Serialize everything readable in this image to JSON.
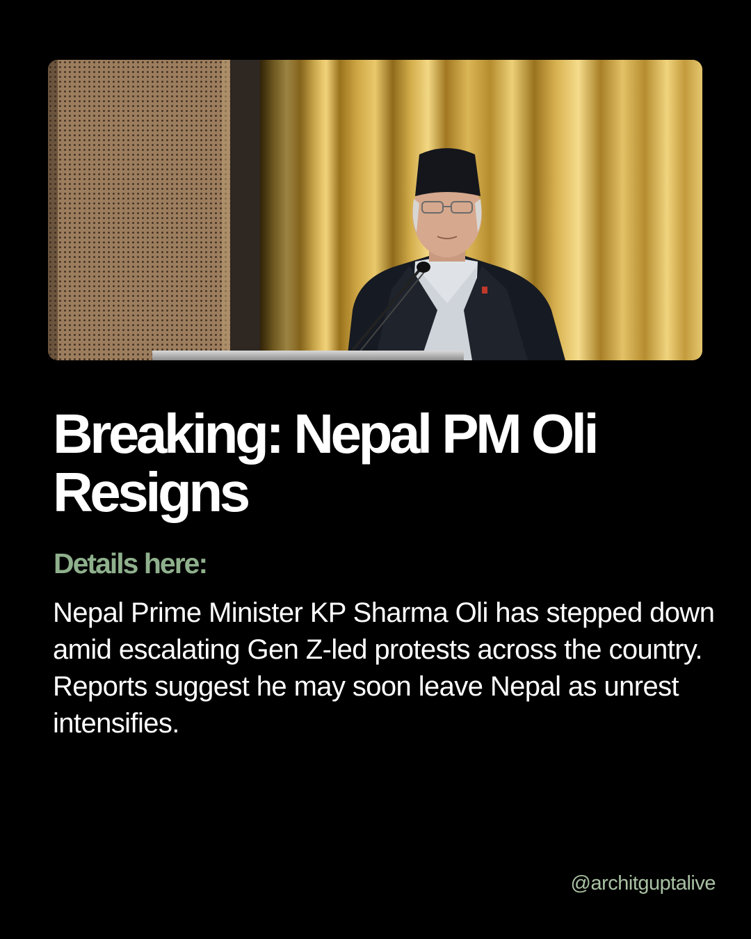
{
  "post": {
    "headline": "Breaking: Nepal PM Oli Resigns",
    "subheading": "Details here:",
    "body": "Nepal Prime Minister KP Sharma Oli has stepped down amid escalating Gen Z-led protests across the country. Reports suggest he may soon leave Nepal as unrest intensifies.",
    "handle": "@architguptalive"
  },
  "photo": {
    "subject": "speaker-at-podium-photo",
    "background": "gold-curtain-and-perforated-wood-panel"
  },
  "colors": {
    "background": "#000000",
    "headline": "#ffffff",
    "subheading": "#8fb08c",
    "body": "#ffffff",
    "handle": "#a9c2a4",
    "curtain": "#c9a33f"
  }
}
